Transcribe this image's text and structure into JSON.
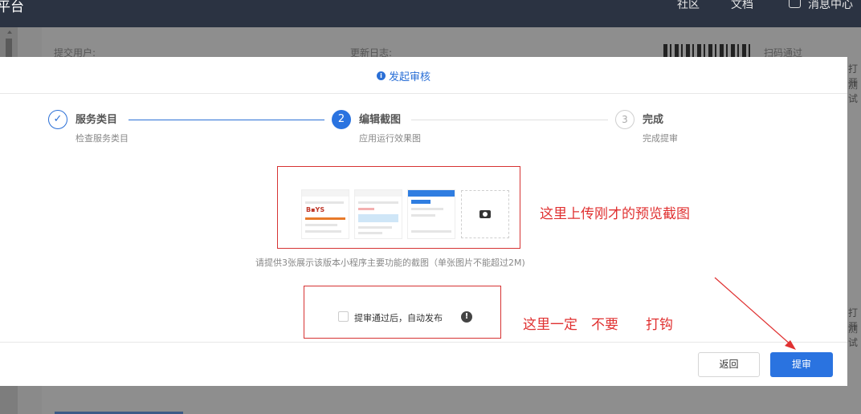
{
  "header": {
    "brand": "平台",
    "nav": [
      {
        "label": "社区"
      },
      {
        "label": "文档"
      },
      {
        "label": "消息中心"
      }
    ]
  },
  "background": {
    "submitter_label": "提交用户:",
    "changelog_label": "更新日志:",
    "scan_label": "扫码通过",
    "edge_right_1": "打开",
    "edge_right_2": "测试",
    "edge_right_3": "打开",
    "edge_right_4": "测试"
  },
  "modal": {
    "title": "发起审核",
    "steps": [
      {
        "number": "✓",
        "title": "服务类目",
        "subtitle": "检查服务类目",
        "state": "done"
      },
      {
        "number": "2",
        "title": "编辑截图",
        "subtitle": "应用运行效果图",
        "state": "active"
      },
      {
        "number": "3",
        "title": "完成",
        "subtitle": "完成提审",
        "state": "pending"
      }
    ],
    "upload_hint": "请提供3张展示该版本小程序主要功能的截图（单张图片不能超过2M)",
    "auto_publish_label": "提审通过后，自动发布",
    "auto_publish_checked": false,
    "buttons": {
      "back": "返回",
      "submit": "提审"
    }
  },
  "annotations": {
    "upload_note": "这里上传刚才的预览截图",
    "checkbox_note": "这里一定　不要　　打钩"
  },
  "colors": {
    "accent": "#2a73e0",
    "annotation": "#e03131",
    "header_bg": "#2b3342"
  }
}
